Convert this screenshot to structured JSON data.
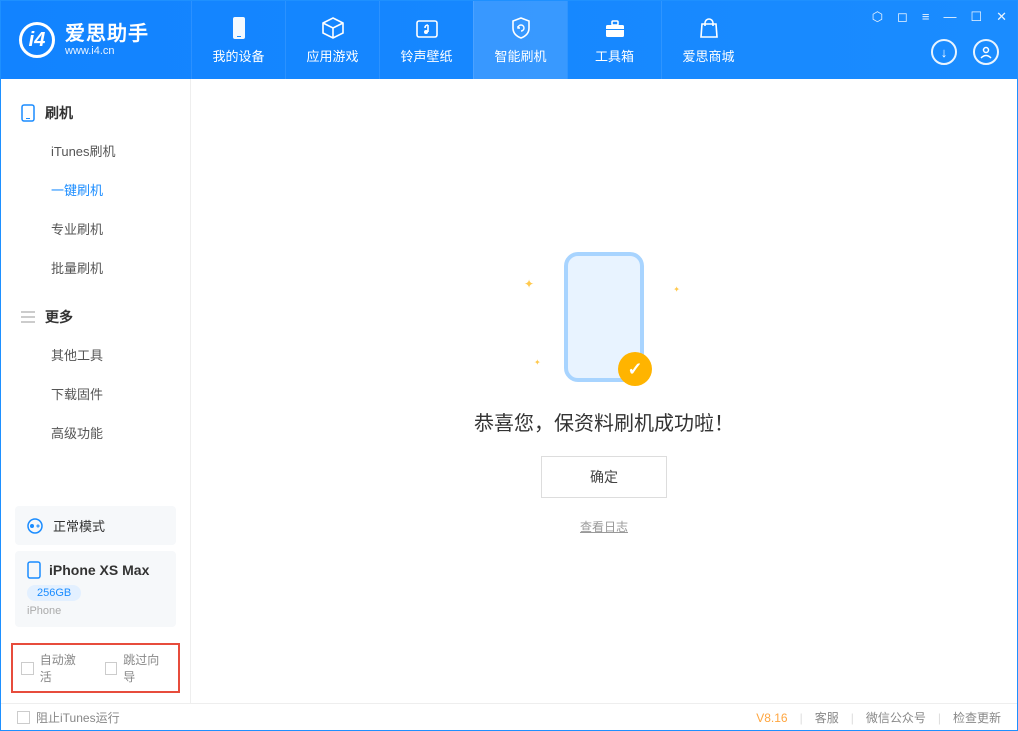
{
  "app": {
    "title": "爱思助手",
    "subtitle": "www.i4.cn"
  },
  "tabs": [
    {
      "label": "我的设备"
    },
    {
      "label": "应用游戏"
    },
    {
      "label": "铃声壁纸"
    },
    {
      "label": "智能刷机"
    },
    {
      "label": "工具箱"
    },
    {
      "label": "爱思商城"
    }
  ],
  "sidebar": {
    "section1": {
      "title": "刷机",
      "items": [
        "iTunes刷机",
        "一键刷机",
        "专业刷机",
        "批量刷机"
      ]
    },
    "section2": {
      "title": "更多",
      "items": [
        "其他工具",
        "下载固件",
        "高级功能"
      ]
    }
  },
  "status_mode": "正常模式",
  "device": {
    "name": "iPhone XS Max",
    "capacity": "256GB",
    "type": "iPhone"
  },
  "options": {
    "auto_activate": "自动激活",
    "skip_guide": "跳过向导"
  },
  "main": {
    "success_message": "恭喜您，保资料刷机成功啦！",
    "ok_button": "确定",
    "view_log": "查看日志"
  },
  "statusbar": {
    "block_itunes": "阻止iTunes运行",
    "version": "V8.16",
    "links": [
      "客服",
      "微信公众号",
      "检查更新"
    ]
  }
}
